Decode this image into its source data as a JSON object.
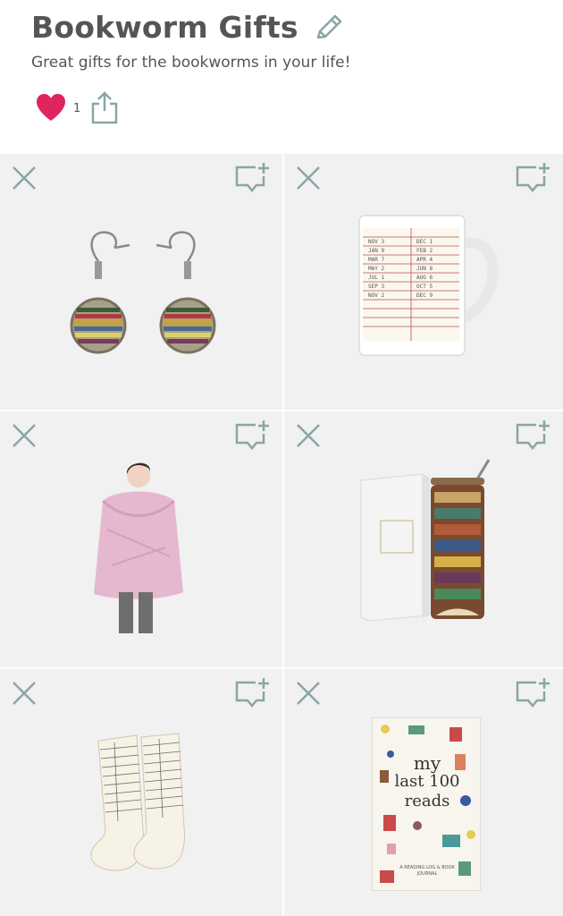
{
  "list": {
    "title": "Bookworm Gifts",
    "description": "Great gifts for the bookworms in your life!",
    "likes": "1"
  },
  "colors": {
    "heart": "#e0245e",
    "icon_teal": "#8aa5a5",
    "card_bg": "#f1f1f1"
  },
  "icons": {
    "edit": "pencil-icon",
    "like": "heart-icon",
    "share": "share-icon",
    "remove": "close-icon",
    "note": "add-note-icon"
  },
  "products": [
    {
      "name": "bookshelf-earrings"
    },
    {
      "name": "library-card-mug"
    },
    {
      "name": "pink-blanket-wrap"
    },
    {
      "name": "reading-tumbler"
    },
    {
      "name": "library-card-socks"
    },
    {
      "name": "reading-journal",
      "cover_text_1": "my",
      "cover_text_2": "last 100",
      "cover_text_3": "reads",
      "cover_subtext": "A READING LOG & BOOK JOURNAL"
    }
  ]
}
